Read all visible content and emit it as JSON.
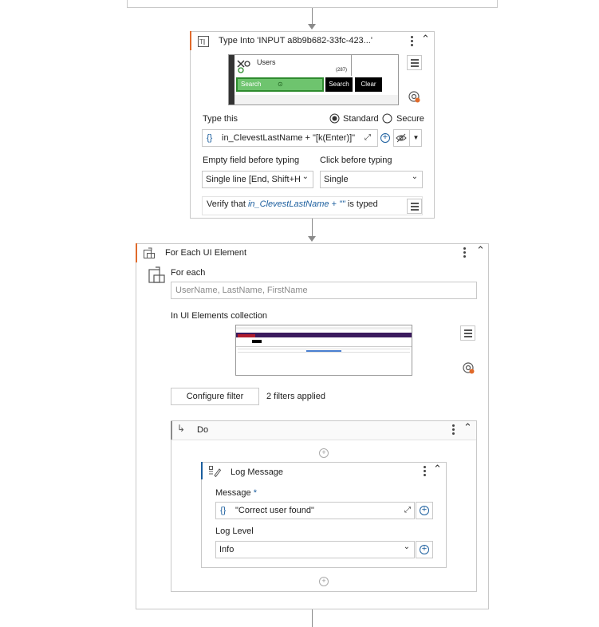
{
  "type_into": {
    "title": "Type Into 'INPUT  a8b9b682-33fc-423...'",
    "preview": {
      "app_title": "Users",
      "count": "(287)",
      "search_placeholder": "Search",
      "search_button": "Search",
      "clear_button": "Clear"
    },
    "type_this_label": "Type this",
    "mode_standard": "Standard",
    "mode_secure": "Secure",
    "expression": "in_ClevestLastName + \"[k(Enter)]\"",
    "empty_field_label": "Empty field before typing",
    "empty_field_value": "Single line [End, Shift+H",
    "click_before_label": "Click before typing",
    "click_before_value": "Single",
    "verify_prefix": "Verify that ",
    "verify_expr": "in_ClevestLastName + \"\"",
    "verify_suffix": " is typed"
  },
  "for_each": {
    "title": "For Each UI Element",
    "for_each_label": "For each",
    "for_each_placeholder": "UserName, LastName, FirstName",
    "collection_label": "In UI Elements collection",
    "configure_filter": "Configure filter",
    "filters_applied": "2 filters applied",
    "do_title": "Do"
  },
  "log_message": {
    "title": "Log Message",
    "message_label": "Message",
    "required_mark": "*",
    "message_value": "\"Correct user found\"",
    "level_label": "Log Level",
    "level_value": "Info"
  },
  "icons": {
    "expand": "⤢",
    "plus": "+",
    "chevron_down": "⌄",
    "collapse": "⌃"
  },
  "colors": {
    "accent_orange": "#e06a2b",
    "accent_blue": "#1b5e9e",
    "preview_green": "#6ec46e"
  }
}
